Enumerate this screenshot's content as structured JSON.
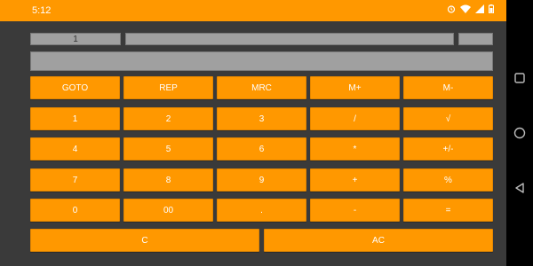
{
  "status_bar": {
    "time": "5:12",
    "icons": [
      "alarm-icon",
      "wifi-icon",
      "signal-icon",
      "battery-icon"
    ]
  },
  "display": {
    "index_value": "1",
    "main_value": "",
    "right_value": "",
    "output_value": ""
  },
  "buttons": {
    "row1": [
      "GOTO",
      "REP",
      "MRC",
      "M+",
      "M-"
    ],
    "row2": [
      "1",
      "2",
      "3",
      "/",
      "√"
    ],
    "row3": [
      "4",
      "5",
      "6",
      "*",
      "+/-"
    ],
    "row4": [
      "7",
      "8",
      "9",
      "+",
      "%"
    ],
    "row5": [
      "0",
      "00",
      ".",
      "-",
      "="
    ],
    "row6": [
      "C",
      "AC"
    ]
  },
  "colors": {
    "accent": "#ff9800",
    "background": "#3a3a3a",
    "display_field": "#a0a0a0",
    "navbar": "#000000"
  },
  "navbar": {
    "icons": [
      "overview-icon",
      "home-icon",
      "back-icon"
    ]
  }
}
